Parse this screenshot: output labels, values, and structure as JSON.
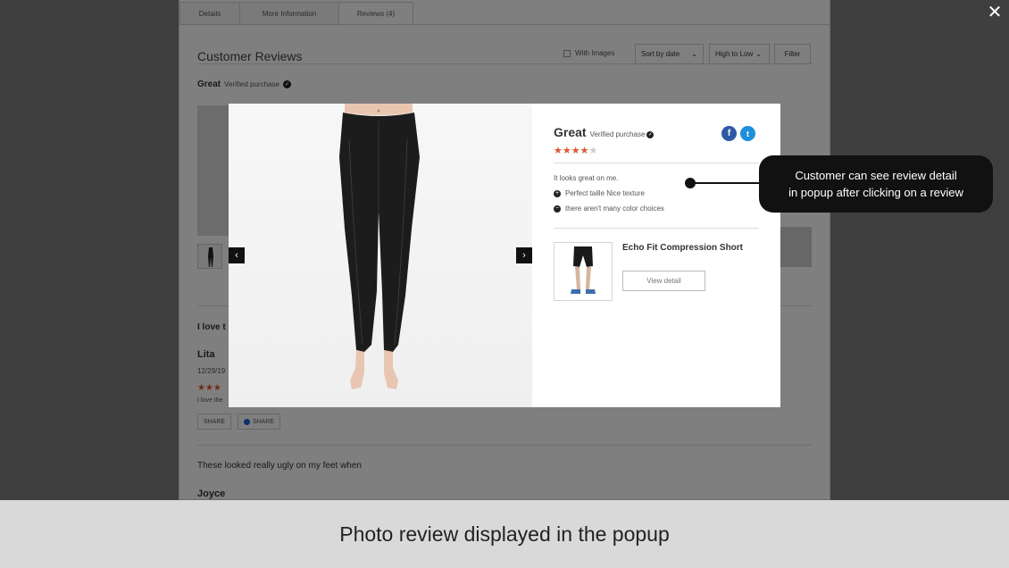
{
  "tabs": [
    {
      "label": "Details"
    },
    {
      "label": "More Information"
    },
    {
      "label": "Reviews (4)"
    }
  ],
  "reviews_section": {
    "title": "Customer Reviews",
    "with_images_label": "With Images",
    "sort_by": "Sort by date",
    "order": "High to Low",
    "filter_label": "Filter",
    "first_review_title": "Great",
    "verified_label": "Verified purchase",
    "second_review_title": "I love t",
    "reviewer": "Lita",
    "date": "12/29/19",
    "review_excerpt": "I love the",
    "share_label": "SHARE",
    "share_fb_label": "SHARE",
    "third_review_title": "These looked really ugly on my feet when",
    "third_reviewer": "Joyce"
  },
  "popup": {
    "title": "Great",
    "verified_label": "Verified purchase",
    "rating": 4,
    "rating_max": 5,
    "comment": "It looks great on me.",
    "pro": "Perfect taille Nice texture",
    "con": "there aren't many color choices",
    "product_name": "Echo Fit Compression Short",
    "view_detail_label": "View detail",
    "prev_icon": "chevron-left-icon",
    "next_icon": "chevron-right-icon"
  },
  "callout": {
    "text": "Customer can see review detail\nin popup after clicking on a review"
  },
  "caption": "Photo review displayed in the popup",
  "colors": {
    "star": "#e6542b",
    "facebook": "#2d5aa8",
    "twitter": "#1d8fe0",
    "callout_bg": "#111111",
    "caption_bg": "#d9d9d9"
  }
}
